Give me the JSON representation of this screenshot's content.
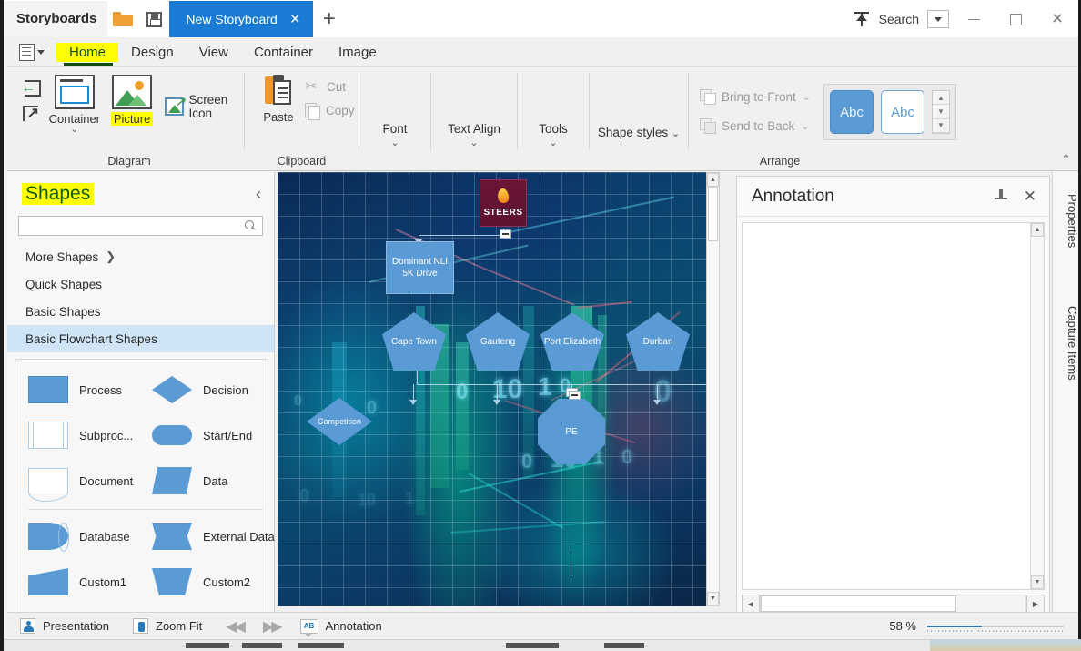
{
  "titlebar": {
    "app_label": "Storyboards",
    "open_icon": "folder-open-icon",
    "save_icon": "save-icon",
    "tab_label": "New Storyboard",
    "tab_close": "×",
    "new_tab": "+",
    "share_icon": "upload-icon",
    "search_label": "Search",
    "minimize": "—",
    "maximize": "□",
    "close": "×"
  },
  "ribbon": {
    "menu_icon": "document-menu-icon",
    "tabs": [
      {
        "label": "Home",
        "active": true,
        "highlight": true
      },
      {
        "label": "Design",
        "active": false,
        "highlight": false
      },
      {
        "label": "View",
        "active": false,
        "highlight": false
      },
      {
        "label": "Container",
        "active": false,
        "highlight": false
      },
      {
        "label": "Image",
        "active": false,
        "highlight": false
      }
    ],
    "groups": {
      "diagram": {
        "title": "Diagram",
        "import_icon": "import-icon",
        "export_icon": "export-icon",
        "container_label": "Container",
        "picture_label": "Picture",
        "screen_icon_label": "Screen Icon"
      },
      "clipboard": {
        "title": "Clipboard",
        "paste_label": "Paste",
        "cut_label": "Cut",
        "copy_label": "Copy"
      },
      "font": {
        "label": "Font"
      },
      "text_align": {
        "label": "Text Align"
      },
      "tools": {
        "label": "Tools"
      },
      "shape_styles": {
        "label": "Shape styles"
      },
      "arrange": {
        "title": "Arrange",
        "bring_to_front": "Bring to Front",
        "send_to_back": "Send to Back",
        "style_fill_label": "Abc",
        "style_outline_label": "Abc"
      }
    }
  },
  "shapes_panel": {
    "title": "Shapes",
    "title_color": "#0d5c17",
    "highlight_color": "#ffff00",
    "collapse_icon": "chevron-left-icon",
    "search_value": "",
    "search_placeholder": "",
    "categories": [
      {
        "label": "More Shapes",
        "has_arrow": true,
        "selected": false
      },
      {
        "label": "Quick Shapes",
        "has_arrow": false,
        "selected": false
      },
      {
        "label": "Basic Shapes",
        "has_arrow": false,
        "selected": false
      },
      {
        "label": "Basic Flowchart Shapes",
        "has_arrow": false,
        "selected": true
      }
    ],
    "shapes_group_a": [
      {
        "label": "Process",
        "shape": "process"
      },
      {
        "label": "Decision",
        "shape": "decision"
      },
      {
        "label": "Subproc...",
        "shape": "subproc"
      },
      {
        "label": "Start/End",
        "shape": "startend"
      },
      {
        "label": "Document",
        "shape": "document"
      },
      {
        "label": "Data",
        "shape": "data"
      }
    ],
    "shapes_group_b": [
      {
        "label": "Database",
        "shape": "database"
      },
      {
        "label": "External Data",
        "shape": "extdata"
      },
      {
        "label": "Custom1",
        "shape": "custom1"
      },
      {
        "label": "Custom2",
        "shape": "custom2"
      }
    ]
  },
  "canvas": {
    "background_description": "abstract blue technology image with teal bar chart, binary digits and network lines",
    "logo": {
      "text": "STEERS",
      "bg_color": "#641233"
    },
    "nodes": [
      {
        "id": "dominant",
        "label": "Dominant NLI 5K Drive",
        "shape": "rectangle"
      },
      {
        "id": "cape-town",
        "label": "Cape Town",
        "shape": "pentagon"
      },
      {
        "id": "gauteng",
        "label": "Gauteng",
        "shape": "pentagon"
      },
      {
        "id": "port-elizabeth",
        "label": "Port Elizabeth",
        "shape": "pentagon"
      },
      {
        "id": "durban",
        "label": "Durban",
        "shape": "pentagon"
      },
      {
        "id": "competition",
        "label": "Competition",
        "shape": "diamond"
      },
      {
        "id": "pe",
        "label": "PE",
        "shape": "octagon"
      }
    ],
    "digits": [
      "0",
      "10",
      "1",
      "0",
      "0",
      "10",
      "1",
      "0",
      "10",
      "1",
      "0"
    ],
    "node_fill": "#5b9bd5"
  },
  "annotation": {
    "title": "Annotation",
    "pin_icon": "pin-icon",
    "close_icon": "close-icon",
    "content": ""
  },
  "right_tabs": [
    {
      "label": "Properties"
    },
    {
      "label": "Capture Items"
    }
  ],
  "statusbar": {
    "presentation_label": "Presentation",
    "zoom_fit_label": "Zoom Fit",
    "prev_icon": "prev-icon",
    "next_icon": "next-icon",
    "annotation_label": "Annotation",
    "zoom_value": "58 %"
  }
}
